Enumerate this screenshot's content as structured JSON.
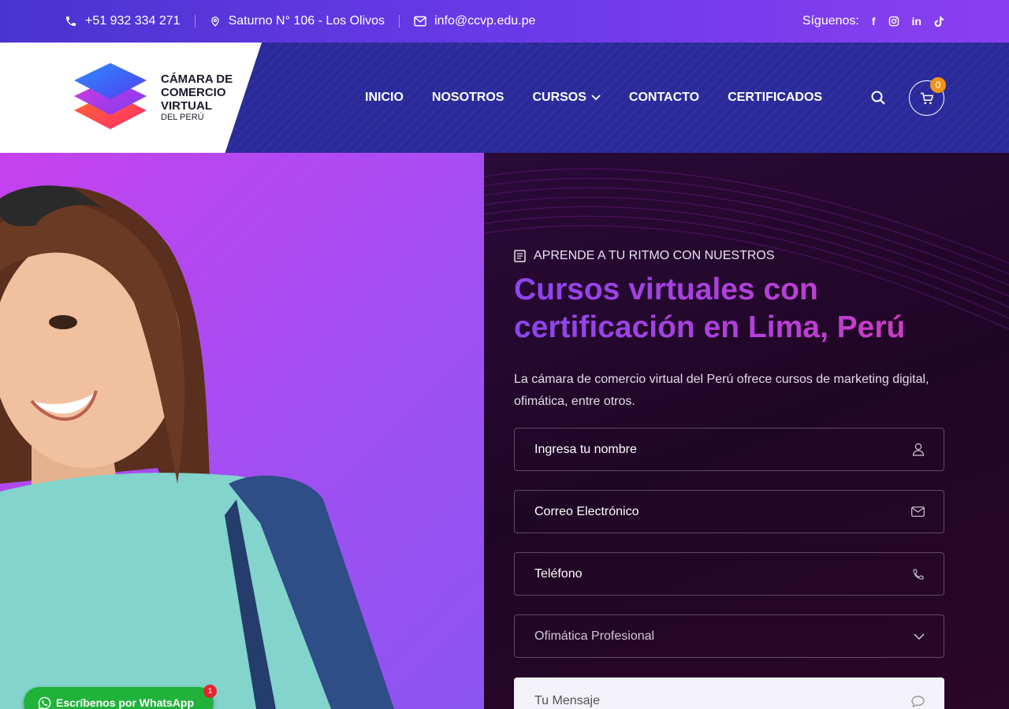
{
  "topbar": {
    "phone": "+51 932 334 271",
    "address": "Saturno N° 106 - Los Olivos",
    "email": "info@ccvp.edu.pe",
    "follow_label": "Síguenos:",
    "social_icons": [
      "facebook-icon",
      "instagram-icon",
      "linkedin-icon",
      "tiktok-icon"
    ],
    "facebook_glyph": "f",
    "linkedin_glyph": "in"
  },
  "logo": {
    "line1": "CÁMARA DE",
    "line2": "COMERCIO",
    "line3": "VIRTUAL",
    "line4": "DEL PERÚ"
  },
  "nav": {
    "items": [
      {
        "label": "INICIO"
      },
      {
        "label": "NOSOTROS"
      },
      {
        "label": "CURSOS",
        "has_dropdown": true
      },
      {
        "label": "CONTACTO"
      },
      {
        "label": "CERTIFICADOS"
      }
    ],
    "cart_count": "0"
  },
  "hero": {
    "eyebrow": "APRENDE A TU RITMO CON NUESTROS",
    "headline_line1": "Cursos virtuales con",
    "headline_line2": "certificación en Lima, Perú",
    "description": "La cámara de comercio virtual del Perú ofrece cursos de marketing digital, ofimática, entre otros."
  },
  "form": {
    "name_placeholder": "Ingresa tu nombre",
    "email_placeholder": "Correo Electrónico",
    "phone_placeholder": "Teléfono",
    "course_selected": "Ofimática Profesional",
    "message_placeholder": "Tu Mensaje"
  },
  "whatsapp": {
    "label": "Escríbenos por WhatsApp",
    "badge": "1"
  },
  "colors": {
    "topbar_start": "#4a34d0",
    "topbar_end": "#8a3ff0",
    "header_bg": "#2a2a9a",
    "hero_left": "#b04cf0",
    "hero_right": "#230828",
    "cart_badge": "#f39418",
    "whatsapp": "#20b23a"
  }
}
